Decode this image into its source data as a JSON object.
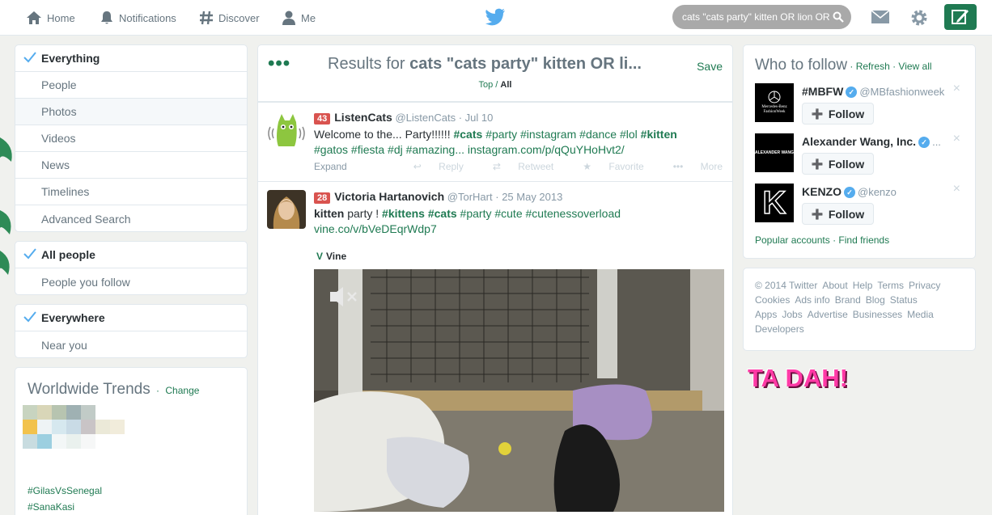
{
  "nav": {
    "home": "Home",
    "notifications": "Notifications",
    "discover": "Discover",
    "me": "Me"
  },
  "search": {
    "query": "cats \"cats party\" kitten OR lion OR"
  },
  "filters": {
    "type": [
      "Everything",
      "People",
      "Photos",
      "Videos",
      "News",
      "Timelines",
      "Advanced Search"
    ],
    "people": [
      "All people",
      "People you follow"
    ],
    "location": [
      "Everywhere",
      "Near you"
    ]
  },
  "trends": {
    "title": "Worldwide Trends",
    "change": "Change",
    "items": [
      "#GilasVsSenegal",
      "#SanaKasi"
    ]
  },
  "results": {
    "prefix": "Results for ",
    "query": "cats \"cats party\" kitten OR li...",
    "save": "Save",
    "tab_top": "Top",
    "tab_sep": " / ",
    "tab_all": "All"
  },
  "tweets": [
    {
      "badge": "43",
      "name": "ListenCats",
      "handle": "@ListenCats",
      "time": "Jul 10",
      "text_a": "Welcome to the... Party!!!!!! ",
      "text_b": "#gatos #fiesta #dj #amazing... instagram.com/p/qQuYHoHvt2/",
      "tags_1": [
        "#cats",
        "#party",
        "#instagram",
        "#dance",
        "#lol",
        "#kitten"
      ],
      "expand": "Expand",
      "actions": [
        "Reply",
        "Retweet",
        "Favorite",
        "More"
      ]
    },
    {
      "badge": "28",
      "name": "Victoria Hartanovich",
      "handle": "@TorHart",
      "time": "25 May 2013",
      "line1_a": "kitten",
      "line1_b": " party ! ",
      "line1_tags": [
        "#kittens",
        "#cats",
        "#party",
        "#cute",
        "#cutenessoverload"
      ],
      "link": "vine.co/v/bVeDEqrWdp7",
      "vine": "Vine"
    }
  ],
  "who_to_follow": {
    "title": "Who to follow",
    "refresh": "Refresh",
    "view_all": "View all",
    "follow_label": "Follow",
    "accounts": [
      {
        "name": "#MBFW",
        "handle": "@MBfashionweek",
        "logo": "Mercedes-Benz FashionWeek"
      },
      {
        "name": "Alexander Wang, Inc.",
        "handle": "...",
        "logo": "ALEXANDER WANG"
      },
      {
        "name": "KENZO",
        "handle": "@kenzo",
        "logo": "K"
      }
    ],
    "popular": "Popular accounts",
    "find": "Find friends"
  },
  "footer": [
    "© 2014 Twitter",
    "About",
    "Help",
    "Terms",
    "Privacy",
    "Cookies",
    "Ads info",
    "Brand",
    "Blog",
    "Status",
    "Apps",
    "Jobs",
    "Advertise",
    "Businesses",
    "Media",
    "Developers"
  ],
  "overlay": "TA DAH!",
  "colors": {
    "accent": "#1f7a52",
    "overlay": "#ff3aa6",
    "badge": "#d9534f"
  }
}
